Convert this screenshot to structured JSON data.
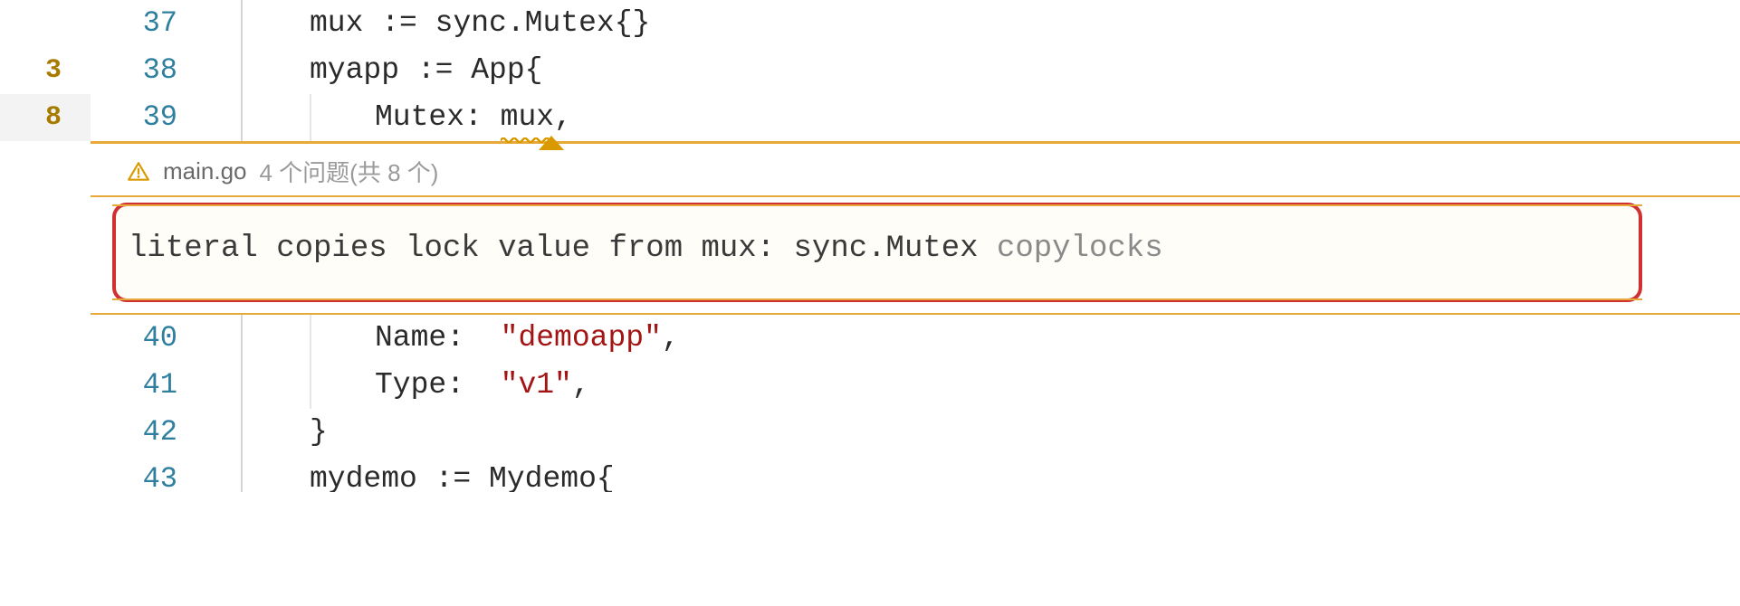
{
  "minimap": {
    "count1": "3",
    "count2": "8"
  },
  "lines": {
    "l37": {
      "num": "37",
      "text_a": "mux",
      "op": " := ",
      "pkg": "sync",
      "dot": ".",
      "type": "Mutex",
      "braces": "{}"
    },
    "l38": {
      "num": "38",
      "text_a": "myapp",
      "op": " := ",
      "type": "App",
      "brace": "{"
    },
    "l39": {
      "num": "39",
      "field": "Mutex",
      "colon": ": ",
      "val": "mux",
      "comma": ","
    },
    "l40": {
      "num": "40",
      "field": "Name",
      "colon": ":  ",
      "val": "\"demoapp\"",
      "comma": ","
    },
    "l41": {
      "num": "41",
      "field": "Type",
      "colon": ":  ",
      "val": "\"v1\"",
      "comma": ","
    },
    "l42": {
      "num": "42",
      "brace": "}"
    },
    "l43": {
      "num": "43",
      "text_a": "mydemo",
      "op": " := ",
      "type": "Mydemo",
      "brace": "{"
    }
  },
  "panel": {
    "filename": "main.go",
    "count_text": "4 个问题(共 8 个)"
  },
  "problem": {
    "message": "literal copies lock value from mux: sync.Mutex",
    "tag": "copylocks"
  }
}
